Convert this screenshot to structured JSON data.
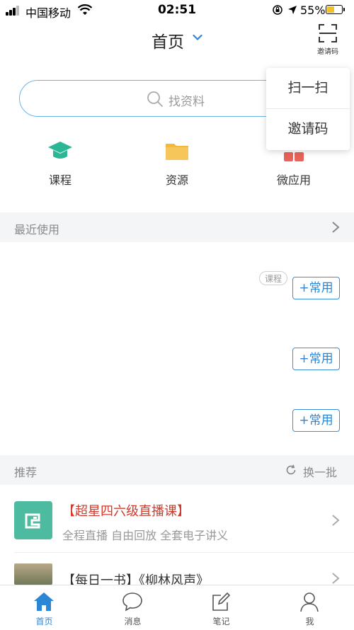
{
  "status_bar": {
    "carrier": "中国移动",
    "time": "02:51",
    "battery": "55%",
    "battery_level": 0.55
  },
  "header": {
    "title": "首页",
    "invite_label": "邀请码"
  },
  "search": {
    "placeholder": "找资料"
  },
  "popup_menu": {
    "items": [
      "扫一扫",
      "邀请码"
    ]
  },
  "shortcuts": [
    {
      "label": "课程",
      "icon": "graduation-cap-icon",
      "color": "#2bb795"
    },
    {
      "label": "资源",
      "icon": "folder-icon",
      "color": "#f5b93a"
    },
    {
      "label": "微应用",
      "icon": "apps-icon",
      "color": "#e8635a"
    }
  ],
  "recent": {
    "title": "最近使用",
    "items": [
      {
        "tag": "课程",
        "button": "+常用"
      },
      {
        "button": "+常用"
      },
      {
        "button": "+常用"
      }
    ]
  },
  "recommend": {
    "title": "推荐",
    "refresh_label": "换一批",
    "items": [
      {
        "title": "【超星四六级直播课】",
        "subtitle": "全程直播  自由回放  全套电子讲义",
        "title_color": "#d0392b"
      },
      {
        "title": "【每日一书】《柳林风声》"
      }
    ]
  },
  "tabbar": {
    "items": [
      {
        "label": "首页",
        "icon": "home-icon",
        "active": true
      },
      {
        "label": "消息",
        "icon": "message-icon"
      },
      {
        "label": "笔记",
        "icon": "note-icon"
      },
      {
        "label": "我",
        "icon": "profile-icon"
      }
    ]
  },
  "colors": {
    "accent": "#2b86d6",
    "search_border": "#67b5e8",
    "section_bg": "#f4f5f7"
  }
}
